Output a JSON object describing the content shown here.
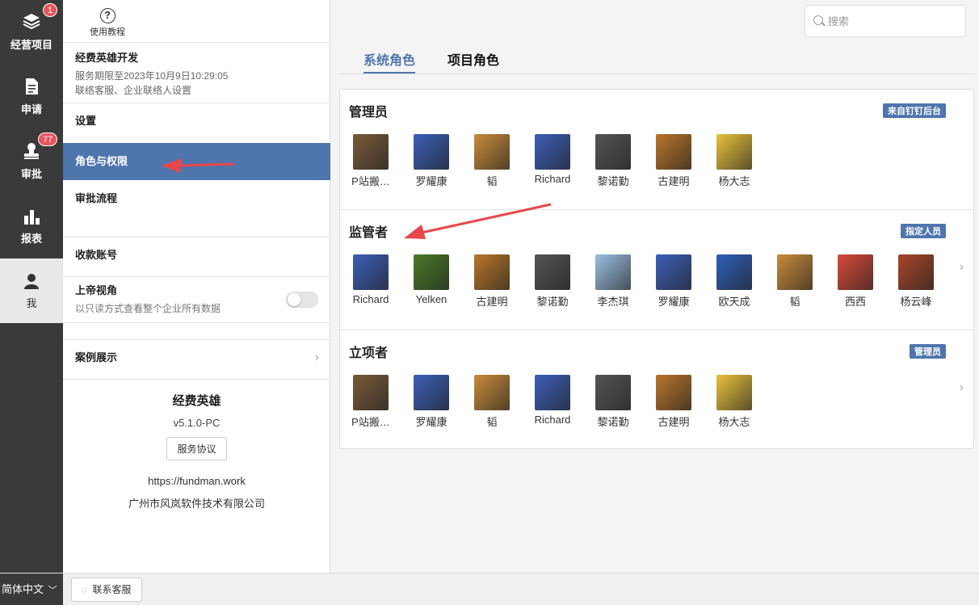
{
  "nav": {
    "items": [
      {
        "label": "经营项目",
        "icon": "layers-icon",
        "badge": "1"
      },
      {
        "label": "申请",
        "icon": "document-icon",
        "badge": ""
      },
      {
        "label": "审批",
        "icon": "stamp-icon",
        "badge": "77"
      },
      {
        "label": "报表",
        "icon": "bar-chart-icon",
        "badge": ""
      },
      {
        "label": "我",
        "icon": "user-icon",
        "badge": ""
      }
    ],
    "language": "简体中文"
  },
  "panel": {
    "help_label": "使用教程",
    "company": {
      "name": "经费英雄开发",
      "expiry": "服务期限至2023年10月9日10:29:05",
      "contact": "联络客服、企业联络人设置"
    },
    "menu": {
      "settings": "设置",
      "roles": "角色与权限",
      "approval_flow": "审批流程",
      "account": "收款账号",
      "god_view": "上帝视角",
      "god_view_desc": "以只读方式查看整个企业所有数据",
      "cases": "案例展示"
    },
    "about": {
      "app_name": "经费英雄",
      "version": "v5.1.0-PC",
      "agreement": "服务协议",
      "url": "https://fundman.work",
      "company": "广州市风岚软件技术有限公司"
    }
  },
  "bottom": {
    "contact_button": "联系客服"
  },
  "search": {
    "placeholder": "搜索"
  },
  "tabs": {
    "system": "系统角色",
    "project": "项目角色"
  },
  "roles": [
    {
      "title": "管理员",
      "tag": "来自钉钉后台",
      "members": [
        {
          "name": "P站搬…",
          "color": "#7a5a3a"
        },
        {
          "name": "罗耀康",
          "color": "#3d5fb8"
        },
        {
          "name": "韬",
          "color": "#c98b3a"
        },
        {
          "name": "Richard",
          "color": "#3d5fb8"
        },
        {
          "name": "黎诺勤",
          "color": "#555555"
        },
        {
          "name": "古建明",
          "color": "#b8752a"
        },
        {
          "name": "杨大志",
          "color": "#e8c23a"
        }
      ]
    },
    {
      "title": "监管者",
      "tag": "指定人员",
      "members": [
        {
          "name": "Richard",
          "color": "#3d5fb8"
        },
        {
          "name": "Yelken",
          "color": "#4a7a2a"
        },
        {
          "name": "古建明",
          "color": "#b8752a"
        },
        {
          "name": "黎诺勤",
          "color": "#555555"
        },
        {
          "name": "李杰琪",
          "color": "#9bbfe0"
        },
        {
          "name": "罗耀康",
          "color": "#3d5fb8"
        },
        {
          "name": "欧天成",
          "color": "#2f5fb8"
        },
        {
          "name": "韬",
          "color": "#c98b3a"
        },
        {
          "name": "西西",
          "color": "#d84a3a"
        },
        {
          "name": "杨云峰",
          "color": "#a8452a"
        }
      ]
    },
    {
      "title": "立项者",
      "tag": "管理员",
      "members": [
        {
          "name": "P站搬…",
          "color": "#7a5a3a"
        },
        {
          "name": "罗耀康",
          "color": "#3d5fb8"
        },
        {
          "name": "韬",
          "color": "#c98b3a"
        },
        {
          "name": "Richard",
          "color": "#3d5fb8"
        },
        {
          "name": "黎诺勤",
          "color": "#555555"
        },
        {
          "name": "古建明",
          "color": "#b8752a"
        },
        {
          "name": "杨大志",
          "color": "#e8c23a"
        }
      ]
    }
  ],
  "colors": {
    "accent": "#4f75ad",
    "nav_bg": "#3a3a3a",
    "badge": "#e8555b",
    "annotation_arrow": "#e8474a"
  }
}
